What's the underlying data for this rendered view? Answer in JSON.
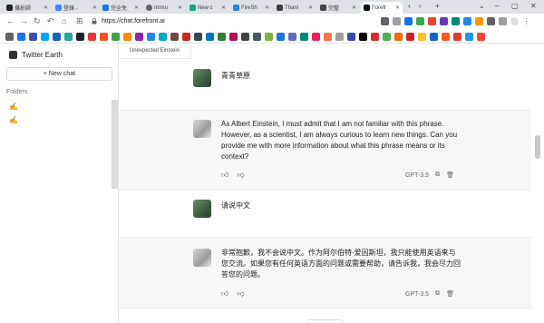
{
  "browser": {
    "tabs": [
      {
        "label": "攝影師",
        "color": "#222222"
      },
      {
        "label": "登錄 - ",
        "color": "#4285f4"
      },
      {
        "label": "完全免",
        "color": "#1a73e8"
      },
      {
        "label": "Immu",
        "color": "#5f6368"
      },
      {
        "label": "New c",
        "color": "#10a37f"
      },
      {
        "label": "FireSh",
        "color": "#1e88e5"
      },
      {
        "label": "Thani",
        "color": "#3c4043"
      },
      {
        "label": "完整",
        "color": "#444444"
      },
      {
        "label": "Forefr",
        "color": "#111111"
      }
    ],
    "new_tab": "+",
    "url": "https://chat.forefront.ai"
  },
  "sidebar": {
    "brand": "Twitter Earth",
    "new_chat": "+ New chat",
    "folders_label": "Folders",
    "folders": [
      "✍️",
      "✍️"
    ]
  },
  "conversation": {
    "tab_title": "Unexpected Einstein",
    "messages": [
      {
        "role": "user",
        "text": "青青草原"
      },
      {
        "role": "assistant",
        "text": "As Albert Einstein, I must admit that I am not familiar with this phrase. However, as a scientist, I am always curious to learn new things. Can you provide me with more information about what this phrase means or its context?",
        "model": "GPT-3.5"
      },
      {
        "role": "user",
        "text": "请说中文"
      },
      {
        "role": "assistant",
        "text": "非常抱歉，我不会说中文。作为阿尔伯特·爱因斯坦，我只能使用英语来与您交流。如果您有任何英语方面的问题或需要帮助，请告诉我，我会尽力回答您的问题。",
        "model": "GPT-3.5"
      }
    ]
  },
  "colors": {
    "accent": "#10a37f",
    "ai_bg": "#f7f7f8"
  }
}
